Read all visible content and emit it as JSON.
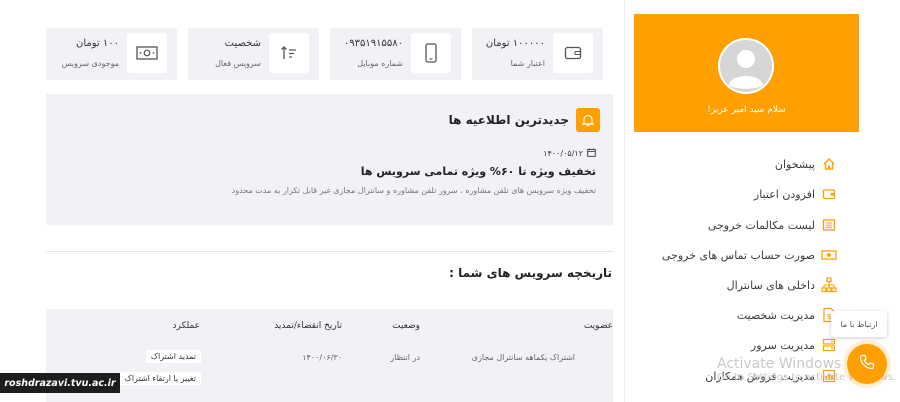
{
  "sidebar": {
    "greeting": "سلام سید امیر عزیز!",
    "items": [
      {
        "label": "پیشخوان",
        "icon": "home-icon"
      },
      {
        "label": "افزودن اعتبار",
        "icon": "wallet-icon"
      },
      {
        "label": "لیست مکالمات خروجی",
        "icon": "list-icon"
      },
      {
        "label": "صورت حساب تماس های خروجی",
        "icon": "cash-icon"
      },
      {
        "label": "داخلی های سانترال",
        "icon": "sitemap-icon"
      },
      {
        "label": "مدیریت شخصیت",
        "icon": "document-dollar-icon"
      },
      {
        "label": "مدیریت سرور",
        "icon": "server-icon"
      },
      {
        "label": "مدیریت فروش همکاران",
        "icon": "chart-icon"
      }
    ]
  },
  "cards": [
    {
      "value": "۱۰۰۰۰۰ تومان",
      "sub": "اعتبار شما",
      "icon": "wallet-icon"
    },
    {
      "value": "۰۹۳۵۱۹۱۵۵۸۰",
      "sub": "شماره موبایل",
      "icon": "mobile-icon"
    },
    {
      "value": "شخصیت",
      "sub": "سرویس فعال",
      "icon": "sort-icon"
    },
    {
      "value": "۱۰۰ تومان",
      "sub": "موجودی سرویس",
      "icon": "money-icon"
    }
  ],
  "announcement": {
    "title": "جدیدترین اطلاعیه ها",
    "date": "۱۴۰۰/۰۵/۱۲",
    "headline": "تخفیف ویژه تا ۶۰% ویژه تمامی سرویس ها",
    "body": "تخفیف ویژه سرویس های تلفن مشاوره ، سرور تلفن مشاوره و سانترال مجازی غیر قابل تکرار به مدت محدود"
  },
  "history": {
    "title": "تاریخچه سرویس های شما :",
    "columns": [
      "عضویت",
      "وضعیت",
      "تاریخ انقضاء/تمدید",
      "عملکرد"
    ],
    "rows": [
      {
        "membership": "اشتراک یکماهه سانترال مجازی",
        "status": "در انتظار",
        "expiry": "۱۴۰۰/۰۶/۳۰",
        "actions": [
          "تمدید اشتراک",
          "تغییر یا ارتقاء اشتراک"
        ]
      }
    ]
  },
  "overlays": {
    "watermark_title": "Activate Windows",
    "watermark_sub": "Go to Settings to activate Windows.",
    "contact_tooltip": "ارتباط با ما",
    "site_badge": "roshdrazavi.tvu.ac.ir"
  },
  "colors": {
    "accent": "#ff9f00",
    "panel": "#f1f2f6"
  }
}
